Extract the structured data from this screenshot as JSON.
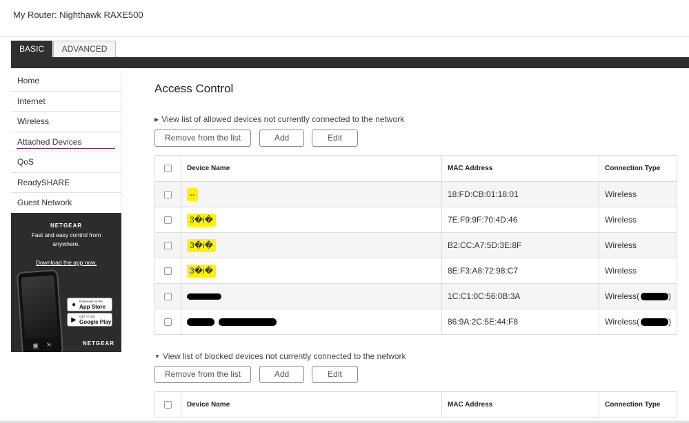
{
  "header": {
    "router_title": "My Router: Nighthawk RAXE500"
  },
  "tabs": {
    "basic": "BASIC",
    "advanced": "ADVANCED"
  },
  "sidebar": {
    "items": [
      {
        "label": "Home"
      },
      {
        "label": "Internet"
      },
      {
        "label": "Wireless"
      },
      {
        "label": "Attached Devices"
      },
      {
        "label": "QoS"
      },
      {
        "label": "ReadySHARE"
      },
      {
        "label": "Guest Network"
      }
    ]
  },
  "promo": {
    "logo": "NETGEAR",
    "text": "Fast and easy control from anywhere.",
    "link": "Download the app now.",
    "app_store_small": "Download on the",
    "app_store_big": "App Store",
    "google_small": "GET IT ON",
    "google_big": "Google Play",
    "brand": "NETGEAR"
  },
  "main": {
    "title": "Access Control",
    "allowed_section": {
      "toggle": "View list of allowed devices not currently connected to the network",
      "buttons": {
        "remove": "Remove from the list",
        "add": "Add",
        "edit": "Edit"
      },
      "columns": {
        "device_name": "Device Name",
        "mac": "MAC Address",
        "connection": "Connection Type"
      },
      "rows": [
        {
          "name": "--",
          "mac": "18:FD:CB:01:18:01",
          "type": "Wireless"
        },
        {
          "name": "3�i�",
          "mac": "7E:F9:9F:70:4D:46",
          "type": "Wireless"
        },
        {
          "name": "3�i�",
          "mac": "B2:CC:A7:5D:3E:8F",
          "type": "Wireless"
        },
        {
          "name": "3�i�",
          "mac": "8E:F3:A8:72:98:C7",
          "type": "Wireless"
        },
        {
          "name": "",
          "mac": "1C:C1:0C:56:0B:3A",
          "type": "Wireless(",
          "type_suffix": ")"
        },
        {
          "name": "",
          "mac": "86:9A:2C:5E:44:F8",
          "type": "Wireless(",
          "type_suffix": ")"
        }
      ]
    },
    "blocked_section": {
      "toggle": "View list of blocked devices not currently connected to the network",
      "buttons": {
        "remove": "Remove from the list",
        "add": "Add",
        "edit": "Edit"
      },
      "columns": {
        "device_name": "Device Name",
        "mac": "MAC Address",
        "connection": "Connection Type"
      }
    }
  },
  "colors": {
    "dark_bar": "#2f2f2f",
    "highlight": "#fff200",
    "active_underline": "#7d2a70"
  }
}
